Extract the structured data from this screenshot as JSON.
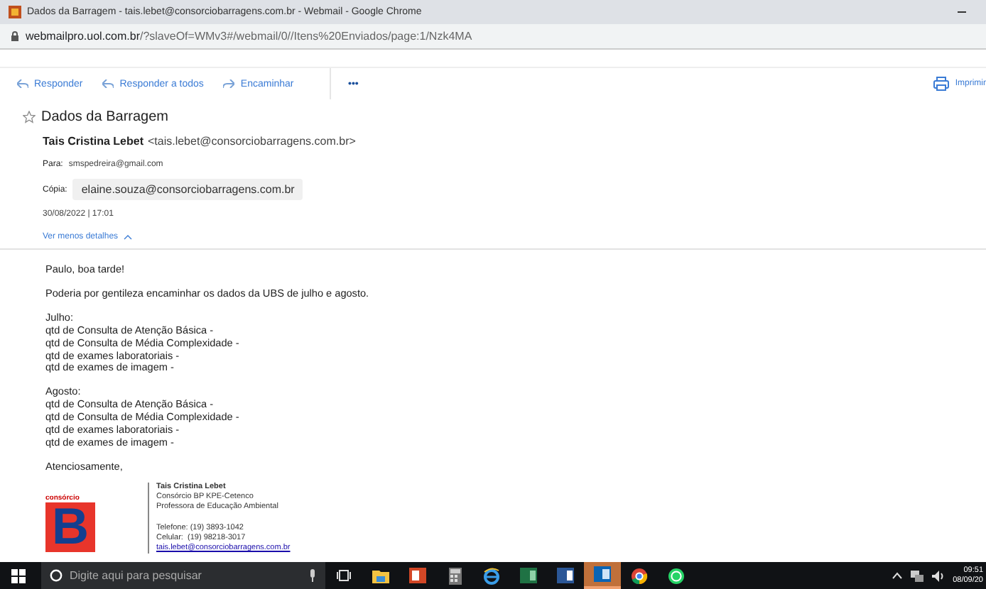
{
  "window": {
    "title": "Dados da Barragem - tais.lebet@consorciobarragens.com.br - Webmail - Google Chrome",
    "url_host": "webmailpro.uol.com.br",
    "url_path": "/?slaveOf=WMv3#/webmail/0//Itens%20Enviados/page:1/Nzk4MA"
  },
  "toolbar": {
    "actions": [
      {
        "kind": "reply",
        "label": "Responder"
      },
      {
        "kind": "reply-all",
        "label": "Responder a todos"
      },
      {
        "kind": "forward",
        "label": "Encaminhar"
      }
    ],
    "more": "•••",
    "print": "Imprimir"
  },
  "message": {
    "subject": "Dados da Barragem",
    "starred": false,
    "sender_name": "Tais Cristina Lebet",
    "sender_email": "<tais.lebet@consorciobarragens.com.br>",
    "to_label": "Para:",
    "to": "smspedreira@gmail.com",
    "cc_label": "Cópia:",
    "cc": "elaine.souza@consorciobarragens.com.br",
    "date": "30/08/2022 | 17:01",
    "details_link": "Ver menos detalhes"
  },
  "body": {
    "paragraphs": [
      {
        "lines": [
          "Paulo, boa tarde!"
        ]
      },
      {
        "lines": [
          "Poderia por gentileza encaminhar os dados da UBS de julho e agosto."
        ]
      },
      {
        "lines": [
          "Julho:",
          "qtd de Consulta de Atenção Básica -",
          "qtd de Consulta de Média Complexidade -",
          "qtd de exames laboratoriais -",
          "qtd de exames de imagem -"
        ]
      },
      {
        "lines": [
          "Agosto:",
          "qtd de Consulta de Atenção Básica -",
          "qtd de Consulta de Média Complexidade -",
          "qtd de exames laboratoriais -",
          "qtd de exames de imagem -"
        ]
      },
      {
        "lines": [
          "Atenciosamente,"
        ]
      }
    ]
  },
  "signature": {
    "logo_text": "consórcio",
    "logo_letter": "B",
    "name": "Tais Cristina Lebet",
    "lines": [
      "Consórcio BP KPE-Cetenco",
      "Professora de Educação Ambiental"
    ],
    "phones": [
      "Telefone: (19) 3893-1042",
      "Celular:  (19) 98218-3017"
    ],
    "email": "tais.lebet@consorciobarragens.com.br"
  },
  "taskbar": {
    "search_placeholder": "Digite aqui para pesquisar",
    "apps": [
      {
        "kind": "taskview",
        "selected": false
      },
      {
        "kind": "folder",
        "selected": false
      },
      {
        "kind": "powerpoint",
        "selected": false
      },
      {
        "kind": "calculator",
        "selected": false
      },
      {
        "kind": "browser",
        "selected": false
      },
      {
        "kind": "excel",
        "selected": false
      },
      {
        "kind": "word",
        "selected": false
      },
      {
        "kind": "outlook",
        "selected": true
      },
      {
        "kind": "chrome",
        "selected": false
      },
      {
        "kind": "whatsapp",
        "selected": false
      }
    ],
    "time": "09:51",
    "date": "08/09/20"
  }
}
